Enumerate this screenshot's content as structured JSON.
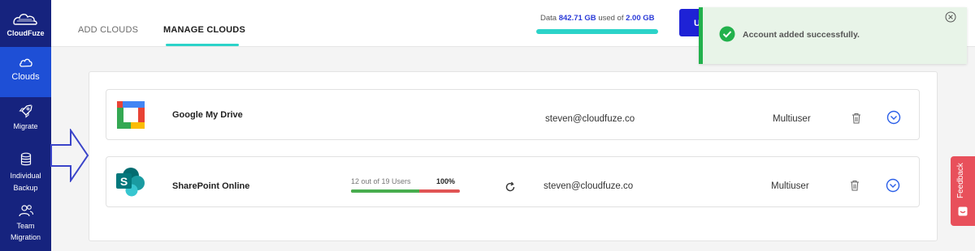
{
  "app": {
    "brand": "CloudFuze"
  },
  "sidebar": {
    "items": [
      {
        "label": "Clouds",
        "icon": "cloud-icon",
        "active": true
      },
      {
        "label": "Migrate",
        "icon": "rocket-icon"
      },
      {
        "label": "Individual Backup",
        "line1": "Individual",
        "line2": "Backup",
        "icon": "database-icon"
      },
      {
        "label": "Team Migration",
        "line1": "Team",
        "line2": "Migration",
        "icon": "users-icon"
      }
    ]
  },
  "tabs": [
    {
      "label": "ADD CLOUDS",
      "active": false
    },
    {
      "label": "MANAGE CLOUDS",
      "active": true
    }
  ],
  "storage": {
    "prefix": "Data",
    "used": "842.71 GB",
    "middle": "used of",
    "total": "2.00 GB"
  },
  "upgrade_button": {
    "label": "U"
  },
  "clouds": [
    {
      "name": "Google My Drive",
      "email": "steven@cloudfuze.co",
      "type": "Multiuser",
      "icon": "google-drive-icon"
    },
    {
      "name": "SharePoint Online",
      "email": "steven@cloudfuze.co",
      "type": "Multiuser",
      "icon": "sharepoint-icon",
      "progress_text": "12 out of 19 Users",
      "progress_pct": "100%",
      "progress_fraction": 0.63
    }
  ],
  "toast": {
    "message": "Account added successfully."
  },
  "feedback": {
    "label": "Feedback"
  },
  "colors": {
    "sidebar": "#16237e",
    "active_nav": "#1e4fd6",
    "accent_teal": "#2cd3c9",
    "button_blue": "#1e22d6",
    "success_green": "#22b14c",
    "progress_green": "#48ad4f",
    "progress_red": "#e05454",
    "feedback_red": "#e8505b"
  }
}
